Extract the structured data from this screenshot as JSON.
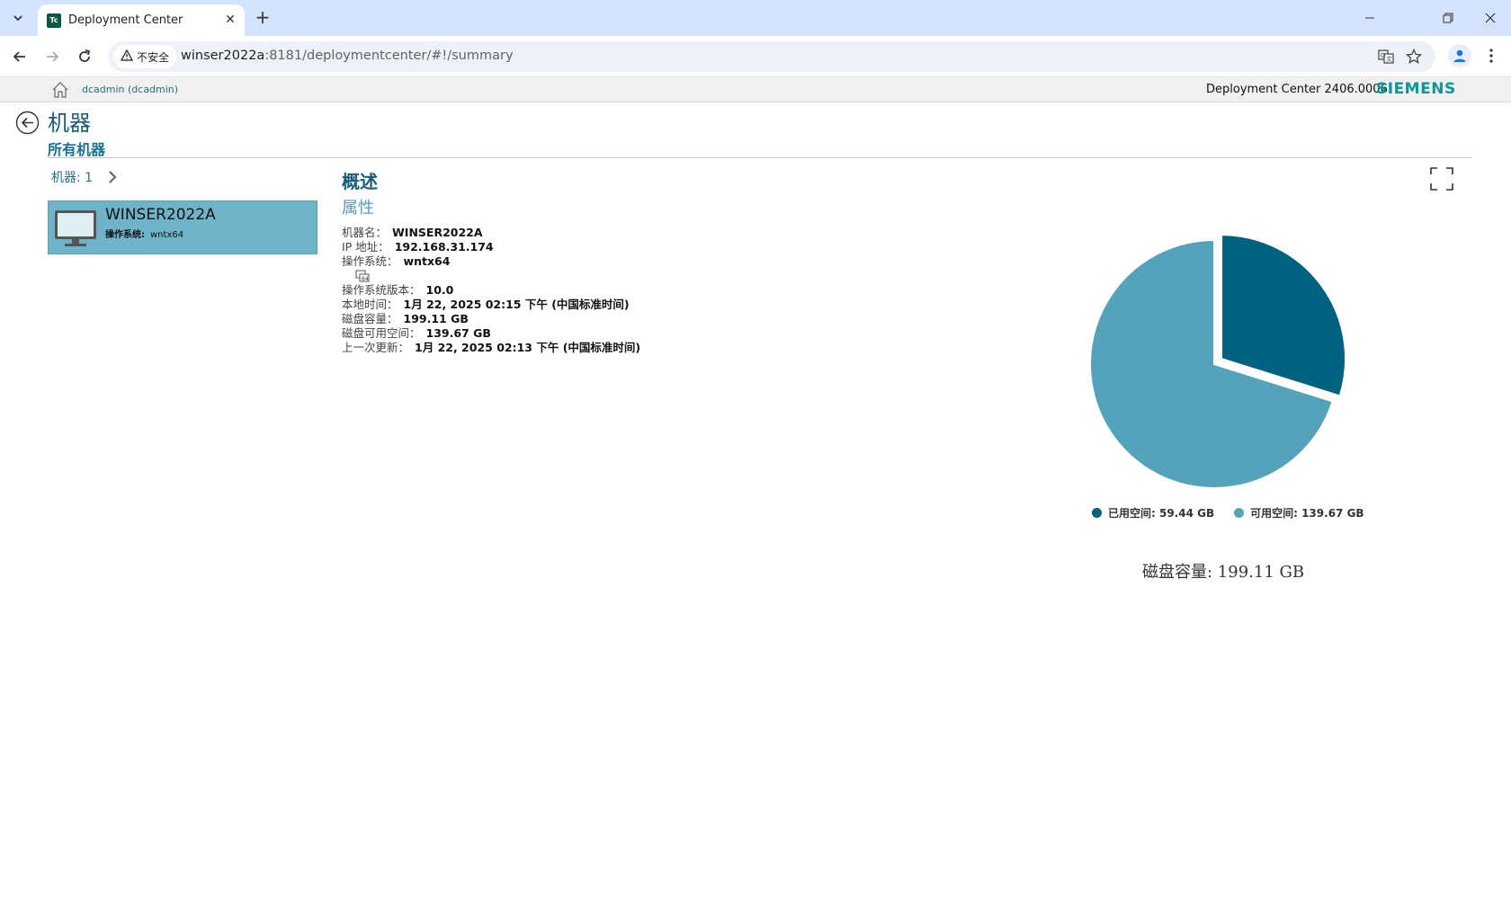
{
  "browser": {
    "tab_title": "Deployment Center",
    "favicon_text": "Tc",
    "security_label": "不安全",
    "url_host": "winser2022a",
    "url_path": ":8181/deploymentcenter/#!/summary"
  },
  "header": {
    "user": "dcadmin (dcadmin)",
    "version": "Deployment Center 2406.0006",
    "brand": "SIEMENS"
  },
  "page": {
    "title": "机器",
    "subtitle": "所有机器"
  },
  "machines": {
    "count_label": "机器: 1",
    "items": [
      {
        "name": "WINSER2022A",
        "os_label": "操作系统:",
        "os_value": "wntx64"
      }
    ]
  },
  "summary": {
    "overview_title": "概述",
    "properties_title": "属性",
    "properties": [
      {
        "key": "机器名：",
        "value": "WINSER2022A"
      },
      {
        "key": "IP 地址：",
        "value": "192.168.31.174"
      },
      {
        "key": "操作系统：",
        "value": "wntx64"
      },
      {
        "key": "操作系统版本：",
        "value": "10.0"
      },
      {
        "key": "本地时间：",
        "value": "1月 22, 2025 02:15 下午 (中国标准时间)"
      },
      {
        "key": "磁盘容量：",
        "value": "199.11 GB"
      },
      {
        "key": "磁盘可用空间：",
        "value": "139.67 GB"
      },
      {
        "key": "上一次更新：",
        "value": "1月 22, 2025 02:13 下午 (中国标准时间)"
      }
    ],
    "os_glyph": "64"
  },
  "colors": {
    "used": "#00627f",
    "free": "#55a3ba",
    "brand": "#009999",
    "card": "#6fb3c9"
  },
  "chart_data": {
    "type": "pie",
    "labels": [
      "已用空间: 59.44 GB",
      "可用空间: 139.67 GB"
    ],
    "values": [
      59.44,
      139.67
    ],
    "unit": "GB",
    "exploded": [
      true,
      false
    ],
    "caption": "磁盘容量: 199.11 GB",
    "legend_position": "bottom"
  }
}
